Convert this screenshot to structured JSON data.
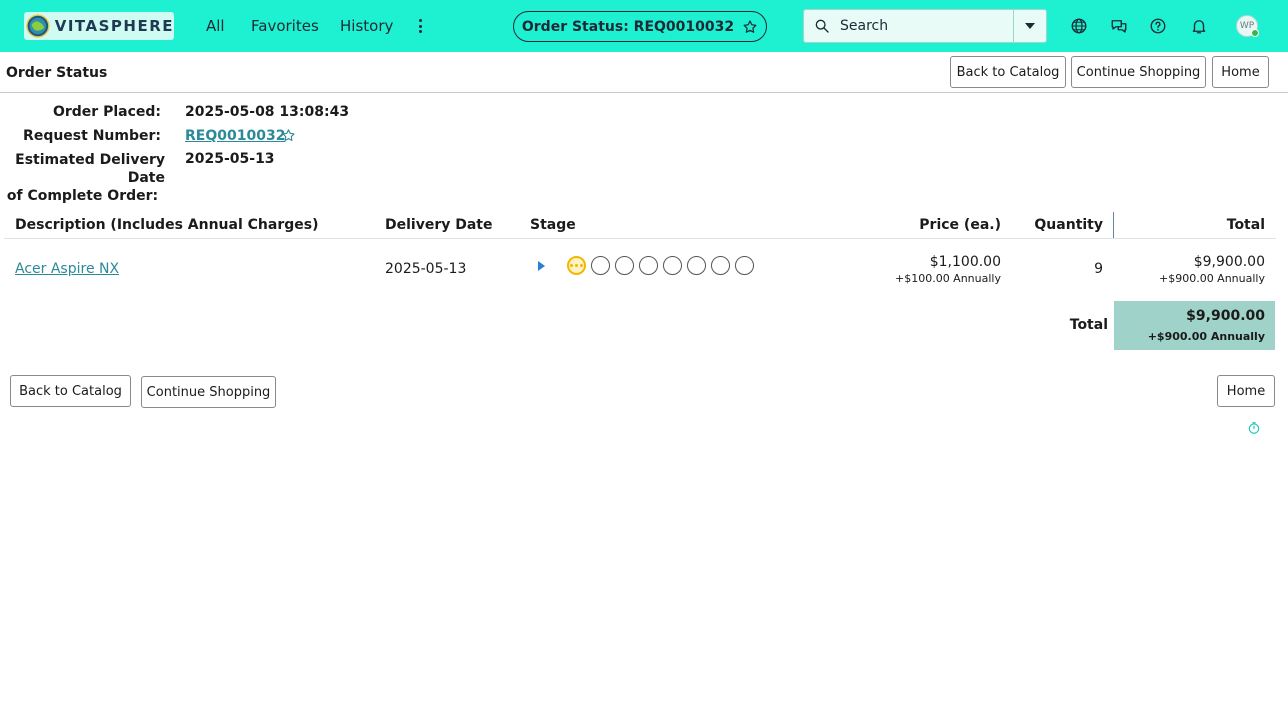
{
  "brand": {
    "name": "VITASPHERE"
  },
  "nav": {
    "items": [
      {
        "label": "All"
      },
      {
        "label": "Favorites"
      },
      {
        "label": "History"
      }
    ],
    "more_icon": "kebab-icon"
  },
  "header": {
    "title": "Order Status: REQ0010032",
    "favorite_icon": "star-icon"
  },
  "search": {
    "placeholder": "Search",
    "icon": "search-icon",
    "dropdown_icon": "caret-down-icon"
  },
  "toolbar_icons": [
    "globe-icon",
    "chat-icon",
    "help-icon",
    "bell-icon"
  ],
  "user": {
    "initials": "WP",
    "status_color": "#3bb44a"
  },
  "page": {
    "title": "Order Status",
    "buttons": {
      "back_to_catalog": "Back to Catalog",
      "continue_shopping": "Continue Shopping",
      "home": "Home"
    }
  },
  "order": {
    "placed_label": "Order Placed:",
    "placed_value": "2025-05-08 13:08:43",
    "request_label": "Request Number:",
    "request_value": "REQ0010032",
    "delivery_label_line1": "Estimated Delivery Date",
    "delivery_label_line2": "of Complete Order:",
    "delivery_value": "2025-05-13"
  },
  "table": {
    "headers": {
      "description": "Description (Includes Annual Charges)",
      "delivery_date": "Delivery Date",
      "stage": "Stage",
      "price": "Price (ea.)",
      "quantity": "Quantity",
      "total": "Total"
    },
    "rows": [
      {
        "description": "Acer Aspire NX",
        "delivery_date": "2025-05-13",
        "stages_total": 8,
        "stage_active_index": 0,
        "price": "$1,100.00",
        "price_annual": "+$100.00 Annually",
        "quantity": "9",
        "total": "$9,900.00",
        "total_annual": "+$900.00 Annually"
      }
    ],
    "grand_total_label": "Total",
    "grand_total": "$9,900.00",
    "grand_total_annual": "+$900.00 Annually"
  },
  "colors": {
    "topbar": "#1ef0d2",
    "link": "#2b8a98",
    "total_highlight": "#9fd2c9",
    "stage_active": "#f2b705"
  }
}
